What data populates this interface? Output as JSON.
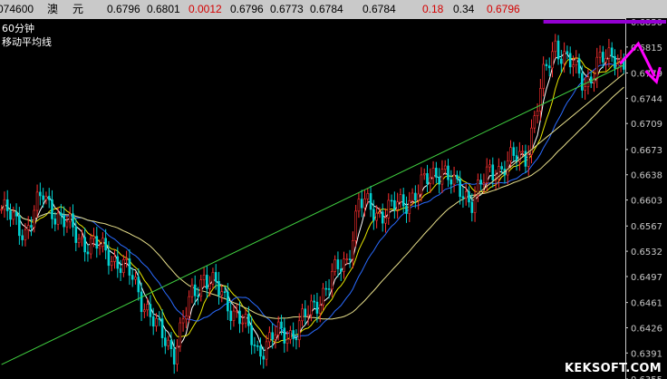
{
  "quote_bar": {
    "code": "074600",
    "name": "澳",
    "name2": "元",
    "open": "0.6796",
    "high": "0.6801",
    "change": "0.0012",
    "last": "0.6796",
    "low": "0.6773",
    "v1": "0.6784",
    "v2": "0.6784",
    "pct": "0.18",
    "amp": "0.34",
    "price": "0.6796"
  },
  "panel": {
    "period": "60分钟",
    "indicator": "移动平均线"
  },
  "watermark": "KEKSOFT.COM",
  "colors": {
    "background": "#000000",
    "up": "#ff3030",
    "down": "#00d2d2",
    "ma_fast": "#ffffff",
    "ma_mid": "#e8e800",
    "ma_slow": "#2a6bff",
    "ma_long": "#e8e08c",
    "trendline": "#40d040",
    "resistance": "#9400d3",
    "arrow": "#ff00ff"
  },
  "chart_data": {
    "type": "candlestick",
    "ylim": [
      0.6355,
      0.6855
    ],
    "y_ticks": [
      "0.6850",
      "0.6815",
      "0.6779",
      "0.6744",
      "0.6709",
      "0.6673",
      "0.6638",
      "0.6603",
      "0.6567",
      "0.6532",
      "0.6497",
      "0.6461",
      "0.6426",
      "0.6391",
      "0.6355"
    ],
    "bars": 210,
    "anchors": [
      [
        0,
        0.659
      ],
      [
        8,
        0.656
      ],
      [
        14,
        0.661
      ],
      [
        20,
        0.6575
      ],
      [
        28,
        0.6545
      ],
      [
        36,
        0.653
      ],
      [
        44,
        0.6495
      ],
      [
        52,
        0.6425
      ],
      [
        58,
        0.6395
      ],
      [
        64,
        0.647
      ],
      [
        68,
        0.65
      ],
      [
        74,
        0.647
      ],
      [
        80,
        0.644
      ],
      [
        86,
        0.6395
      ],
      [
        92,
        0.6415
      ],
      [
        98,
        0.642
      ],
      [
        104,
        0.645
      ],
      [
        110,
        0.649
      ],
      [
        116,
        0.652
      ],
      [
        120,
        0.66
      ],
      [
        126,
        0.6585
      ],
      [
        134,
        0.6595
      ],
      [
        142,
        0.6625
      ],
      [
        148,
        0.665
      ],
      [
        152,
        0.662
      ],
      [
        158,
        0.6605
      ],
      [
        164,
        0.664
      ],
      [
        170,
        0.6655
      ],
      [
        176,
        0.6665
      ],
      [
        182,
        0.677
      ],
      [
        186,
        0.682
      ],
      [
        192,
        0.6785
      ],
      [
        196,
        0.6765
      ],
      [
        200,
        0.679
      ],
      [
        206,
        0.6805
      ],
      [
        209,
        0.679
      ]
    ],
    "trendline": {
      "from": [
        0,
        0.6375
      ],
      "to": [
        209,
        0.679
      ]
    },
    "resistance": {
      "from": [
        182,
        0.685
      ],
      "to": [
        209,
        0.685
      ]
    },
    "support": {
      "from": [
        158,
        0.6605
      ],
      "to": [
        209,
        0.6778
      ]
    },
    "moving_averages": [
      {
        "key": "ma_fast",
        "period": 5
      },
      {
        "key": "ma_mid",
        "period": 10
      },
      {
        "key": "ma_slow",
        "period": 20
      },
      {
        "key": "ma_long",
        "period": 40
      }
    ]
  }
}
